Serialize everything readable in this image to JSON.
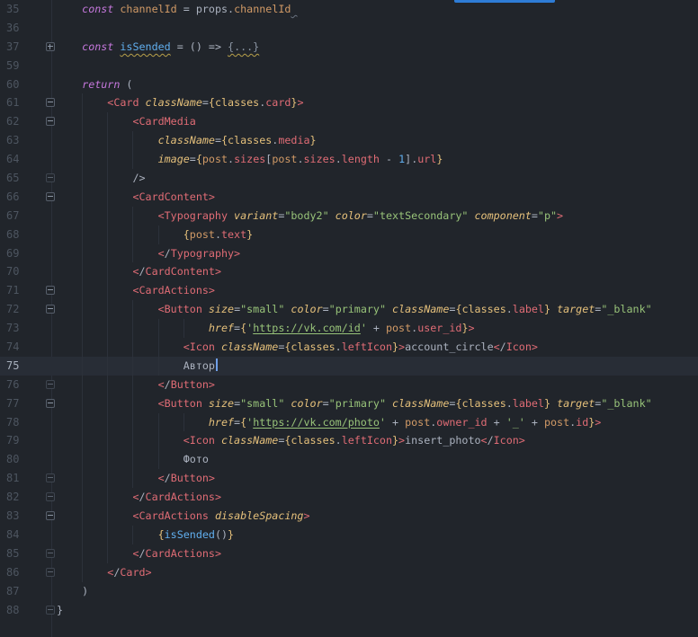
{
  "editor": {
    "language": "JSX",
    "visible_line_range": {
      "first": 35,
      "last": 88,
      "folded_gap_after": 37,
      "resumes_at": 59
    },
    "current_line": 75,
    "caret_after_text": "Автор",
    "tab_indicator_color": "#2e7cd6",
    "colors": {
      "background": "#21252b",
      "current_line_background": "#282d36",
      "line_number": "#4d5560",
      "active_line_number": "#a8b1bd",
      "indent_guide": "#2c313a",
      "keyword": "#c678dd",
      "variable": "#d19a66",
      "property": "#e06c75",
      "jsx_tag": "#e06c75",
      "attribute": "#e5c07b",
      "string": "#98c379",
      "number": "#61afef",
      "function": "#61afef",
      "plain_text": "#abb2bf",
      "folded_region": "#8b95a3",
      "warning_squiggle": "#b8a14a",
      "caret": "#6f9fe8"
    },
    "lines": [
      {
        "num": 35,
        "indent": 4,
        "tokens": [
          [
            "k",
            "const"
          ],
          [
            "w",
            " "
          ],
          [
            "v",
            "channelId"
          ],
          [
            "w",
            " = "
          ],
          [
            "w",
            "props."
          ],
          [
            "v",
            "channelId"
          ],
          [
            "h",
            " "
          ]
        ]
      },
      {
        "num": 36,
        "indent": 0,
        "tokens": []
      },
      {
        "num": 37,
        "indent": 4,
        "marker": "plus",
        "tokens": [
          [
            "k",
            "const"
          ],
          [
            "w",
            " "
          ],
          [
            "fw",
            "isSended"
          ],
          [
            "w",
            " = () => "
          ],
          [
            "d",
            "{...}"
          ]
        ]
      },
      {
        "num": 59,
        "indent": 0,
        "tokens": []
      },
      {
        "num": 60,
        "indent": 4,
        "tokens": [
          [
            "k",
            "return"
          ],
          [
            "w",
            " ("
          ]
        ]
      },
      {
        "num": 61,
        "indent": 8,
        "marker": "minus",
        "tokens": [
          [
            "t",
            "<Card"
          ],
          [
            "w",
            " "
          ],
          [
            "a",
            "className"
          ],
          [
            "w",
            "="
          ],
          [
            "y",
            "{classes"
          ],
          [
            "w",
            "."
          ],
          [
            "p",
            "card"
          ],
          [
            "y",
            "}"
          ],
          [
            "t",
            ">"
          ]
        ]
      },
      {
        "num": 62,
        "indent": 12,
        "marker": "minus",
        "tokens": [
          [
            "t",
            "<CardMedia"
          ]
        ]
      },
      {
        "num": 63,
        "indent": 16,
        "tokens": [
          [
            "a",
            "className"
          ],
          [
            "w",
            "="
          ],
          [
            "y",
            "{classes"
          ],
          [
            "w",
            "."
          ],
          [
            "p",
            "media"
          ],
          [
            "y",
            "}"
          ]
        ]
      },
      {
        "num": 64,
        "indent": 16,
        "tokens": [
          [
            "a",
            "image"
          ],
          [
            "w",
            "="
          ],
          [
            "y",
            "{"
          ],
          [
            "v",
            "post"
          ],
          [
            "w",
            "."
          ],
          [
            "p",
            "sizes"
          ],
          [
            "w",
            "["
          ],
          [
            "v",
            "post"
          ],
          [
            "w",
            "."
          ],
          [
            "p",
            "sizes"
          ],
          [
            "w",
            "."
          ],
          [
            "p",
            "length"
          ],
          [
            "w",
            " - "
          ],
          [
            "n",
            "1"
          ],
          [
            "w",
            "]."
          ],
          [
            "p",
            "url"
          ],
          [
            "y",
            "}"
          ]
        ]
      },
      {
        "num": 65,
        "indent": 12,
        "marker": "dim",
        "tokens": [
          [
            "w",
            "/>"
          ]
        ]
      },
      {
        "num": 66,
        "indent": 12,
        "marker": "minus",
        "tokens": [
          [
            "t",
            "<CardContent>"
          ]
        ]
      },
      {
        "num": 67,
        "indent": 16,
        "tokens": [
          [
            "t",
            "<Typography"
          ],
          [
            "w",
            " "
          ],
          [
            "a",
            "variant"
          ],
          [
            "w",
            "="
          ],
          [
            "s",
            "\"body2\""
          ],
          [
            "w",
            " "
          ],
          [
            "a",
            "color"
          ],
          [
            "w",
            "="
          ],
          [
            "s",
            "\"textSecondary\""
          ],
          [
            "w",
            " "
          ],
          [
            "a",
            "component"
          ],
          [
            "w",
            "="
          ],
          [
            "s",
            "\"p\""
          ],
          [
            "t",
            ">"
          ]
        ]
      },
      {
        "num": 68,
        "indent": 20,
        "tokens": [
          [
            "y",
            "{"
          ],
          [
            "v",
            "post"
          ],
          [
            "w",
            "."
          ],
          [
            "p",
            "text"
          ],
          [
            "y",
            "}"
          ]
        ]
      },
      {
        "num": 69,
        "indent": 16,
        "tokens": [
          [
            "t",
            "<"
          ],
          [
            "w",
            "/"
          ],
          [
            "t",
            "Typography>"
          ]
        ]
      },
      {
        "num": 70,
        "indent": 12,
        "tokens": [
          [
            "t",
            "<"
          ],
          [
            "w",
            "/"
          ],
          [
            "t",
            "CardContent>"
          ]
        ]
      },
      {
        "num": 71,
        "indent": 12,
        "marker": "minus",
        "tokens": [
          [
            "t",
            "<CardActions>"
          ]
        ]
      },
      {
        "num": 72,
        "indent": 16,
        "marker": "minus",
        "tokens": [
          [
            "t",
            "<Button"
          ],
          [
            "w",
            " "
          ],
          [
            "a",
            "size"
          ],
          [
            "w",
            "="
          ],
          [
            "s",
            "\"small\""
          ],
          [
            "w",
            " "
          ],
          [
            "a",
            "color"
          ],
          [
            "w",
            "="
          ],
          [
            "s",
            "\"primary\""
          ],
          [
            "w",
            " "
          ],
          [
            "a",
            "className"
          ],
          [
            "w",
            "="
          ],
          [
            "y",
            "{classes"
          ],
          [
            "w",
            "."
          ],
          [
            "p",
            "label"
          ],
          [
            "y",
            "}"
          ],
          [
            "w",
            " "
          ],
          [
            "a",
            "target"
          ],
          [
            "w",
            "="
          ],
          [
            "s",
            "\"_blank\""
          ]
        ]
      },
      {
        "num": 73,
        "indent": 24,
        "tokens": [
          [
            "a",
            "href"
          ],
          [
            "w",
            "="
          ],
          [
            "y",
            "{"
          ],
          [
            "s",
            "'"
          ],
          [
            "u",
            "https://vk.com/id"
          ],
          [
            "s",
            "'"
          ],
          [
            "w",
            " + "
          ],
          [
            "v",
            "post"
          ],
          [
            "w",
            "."
          ],
          [
            "p",
            "user_id"
          ],
          [
            "y",
            "}"
          ],
          [
            "t",
            ">"
          ]
        ]
      },
      {
        "num": 74,
        "indent": 20,
        "tokens": [
          [
            "t",
            "<Icon"
          ],
          [
            "w",
            " "
          ],
          [
            "a",
            "className"
          ],
          [
            "w",
            "="
          ],
          [
            "y",
            "{classes"
          ],
          [
            "w",
            "."
          ],
          [
            "p",
            "leftIcon"
          ],
          [
            "y",
            "}"
          ],
          [
            "t",
            ">"
          ],
          [
            "w",
            "account_circle"
          ],
          [
            "t",
            "<"
          ],
          [
            "w",
            "/"
          ],
          [
            "t",
            "Icon>"
          ]
        ]
      },
      {
        "num": 75,
        "indent": 20,
        "current": true,
        "caret": true,
        "tokens": [
          [
            "w",
            "Автор"
          ]
        ]
      },
      {
        "num": 76,
        "indent": 16,
        "marker": "dim",
        "tokens": [
          [
            "t",
            "<"
          ],
          [
            "w",
            "/"
          ],
          [
            "t",
            "Button>"
          ]
        ]
      },
      {
        "num": 77,
        "indent": 16,
        "marker": "minus",
        "tokens": [
          [
            "t",
            "<Button"
          ],
          [
            "w",
            " "
          ],
          [
            "a",
            "size"
          ],
          [
            "w",
            "="
          ],
          [
            "s",
            "\"small\""
          ],
          [
            "w",
            " "
          ],
          [
            "a",
            "color"
          ],
          [
            "w",
            "="
          ],
          [
            "s",
            "\"primary\""
          ],
          [
            "w",
            " "
          ],
          [
            "a",
            "className"
          ],
          [
            "w",
            "="
          ],
          [
            "y",
            "{classes"
          ],
          [
            "w",
            "."
          ],
          [
            "p",
            "label"
          ],
          [
            "y",
            "}"
          ],
          [
            "w",
            " "
          ],
          [
            "a",
            "target"
          ],
          [
            "w",
            "="
          ],
          [
            "s",
            "\"_blank\""
          ]
        ]
      },
      {
        "num": 78,
        "indent": 24,
        "tokens": [
          [
            "a",
            "href"
          ],
          [
            "w",
            "="
          ],
          [
            "y",
            "{"
          ],
          [
            "s",
            "'"
          ],
          [
            "u",
            "https://vk.com/photo"
          ],
          [
            "s",
            "'"
          ],
          [
            "w",
            " + "
          ],
          [
            "v",
            "post"
          ],
          [
            "w",
            "."
          ],
          [
            "p",
            "owner_id"
          ],
          [
            "w",
            " + "
          ],
          [
            "s",
            "'_'"
          ],
          [
            "w",
            " + "
          ],
          [
            "v",
            "post"
          ],
          [
            "w",
            "."
          ],
          [
            "p",
            "id"
          ],
          [
            "y",
            "}"
          ],
          [
            "t",
            ">"
          ]
        ]
      },
      {
        "num": 79,
        "indent": 20,
        "tokens": [
          [
            "t",
            "<Icon"
          ],
          [
            "w",
            " "
          ],
          [
            "a",
            "className"
          ],
          [
            "w",
            "="
          ],
          [
            "y",
            "{classes"
          ],
          [
            "w",
            "."
          ],
          [
            "p",
            "leftIcon"
          ],
          [
            "y",
            "}"
          ],
          [
            "t",
            ">"
          ],
          [
            "w",
            "insert_photo"
          ],
          [
            "t",
            "<"
          ],
          [
            "w",
            "/"
          ],
          [
            "t",
            "Icon>"
          ]
        ]
      },
      {
        "num": 80,
        "indent": 20,
        "tokens": [
          [
            "w",
            "Фото"
          ]
        ]
      },
      {
        "num": 81,
        "indent": 16,
        "marker": "dim",
        "tokens": [
          [
            "t",
            "<"
          ],
          [
            "w",
            "/"
          ],
          [
            "t",
            "Button>"
          ]
        ]
      },
      {
        "num": 82,
        "indent": 12,
        "marker": "dim",
        "tokens": [
          [
            "t",
            "<"
          ],
          [
            "w",
            "/"
          ],
          [
            "t",
            "CardActions>"
          ]
        ]
      },
      {
        "num": 83,
        "indent": 12,
        "marker": "minus",
        "tokens": [
          [
            "t",
            "<CardActions"
          ],
          [
            "w",
            " "
          ],
          [
            "a",
            "disableSpacing"
          ],
          [
            "t",
            ">"
          ]
        ]
      },
      {
        "num": 84,
        "indent": 16,
        "tokens": [
          [
            "y",
            "{"
          ],
          [
            "f",
            "isSended"
          ],
          [
            "w",
            "()"
          ],
          [
            "y",
            "}"
          ]
        ]
      },
      {
        "num": 85,
        "indent": 12,
        "marker": "dim",
        "tokens": [
          [
            "t",
            "<"
          ],
          [
            "w",
            "/"
          ],
          [
            "t",
            "CardActions>"
          ]
        ]
      },
      {
        "num": 86,
        "indent": 8,
        "marker": "dim",
        "tokens": [
          [
            "t",
            "<"
          ],
          [
            "w",
            "/"
          ],
          [
            "t",
            "Card>"
          ]
        ]
      },
      {
        "num": 87,
        "indent": 4,
        "tokens": [
          [
            "w",
            ")"
          ]
        ]
      },
      {
        "num": 88,
        "indent": 0,
        "marker": "dim",
        "tokens": [
          [
            "w",
            "}"
          ]
        ]
      }
    ]
  }
}
